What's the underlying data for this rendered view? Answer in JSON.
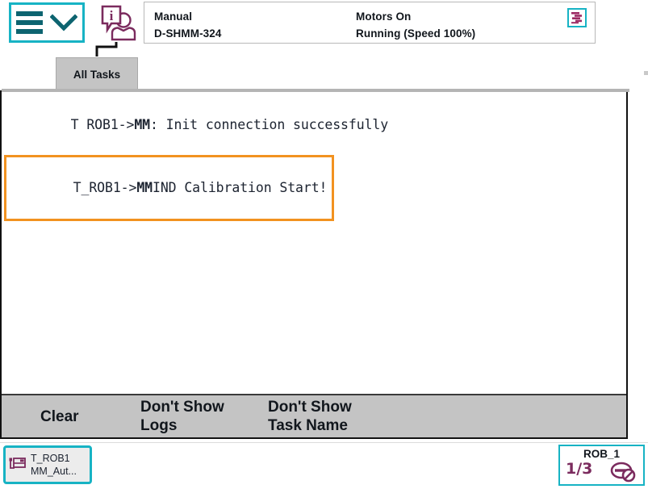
{
  "header": {
    "menu_button_label": "menu",
    "operator_icon": "operator-info-icon",
    "tab_label": "All Tasks",
    "status": {
      "mode": "Manual",
      "controller": "D-SHMM-324",
      "motors": "Motors On",
      "execution": "Running (Speed 100%)",
      "robot_badge_icon": "robot-arm-icon"
    }
  },
  "log": {
    "lines": [
      {
        "prefix": "T ROB1->",
        "bold": "MM",
        "rest": ": Init connection successfully",
        "selected": false
      },
      {
        "prefix": "T_ROB1->",
        "bold": "MM",
        "rest": "IND Calibration Start!",
        "selected": true
      }
    ]
  },
  "buttons": {
    "clear": "Clear",
    "dont_show_logs": "Don't Show\nLogs",
    "dont_show_task_name": "Don't Show\nTask Name"
  },
  "bottom": {
    "task_chip": {
      "icon": "program-pointer-icon",
      "line1": "T_ROB1",
      "line2": "MM_Aut..."
    },
    "robot_chip": {
      "title": "ROB_1",
      "fraction": "1/3",
      "icon": "jog-axis-icon"
    }
  },
  "colors": {
    "accent_teal": "#17b3c4",
    "icon_purple": "#7b2b5e",
    "selection_orange": "#f29220",
    "bar_gray": "#c4c4c4"
  }
}
